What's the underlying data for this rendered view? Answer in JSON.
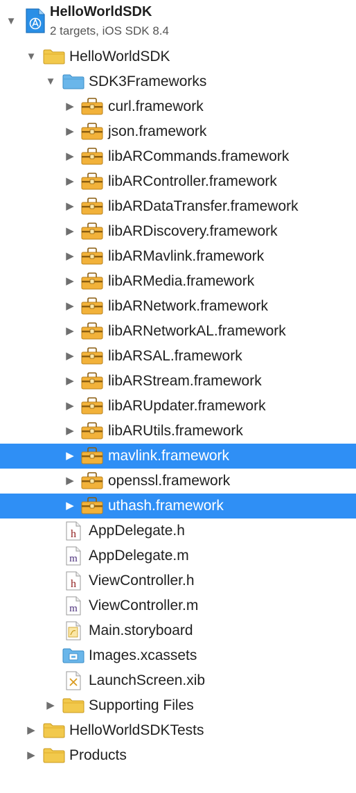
{
  "project": {
    "title": "HelloWorldSDK",
    "subtitle": "2 targets, iOS SDK 8.4",
    "icon": "xcode-project-icon"
  },
  "groups": {
    "main": "HelloWorldSDK",
    "frameworks": "SDK3Frameworks",
    "supporting": "Supporting Files",
    "tests": "HelloWorldSDKTests",
    "products": "Products"
  },
  "frameworks": [
    {
      "label": "curl.framework",
      "selected": false
    },
    {
      "label": "json.framework",
      "selected": false
    },
    {
      "label": "libARCommands.framework",
      "selected": false
    },
    {
      "label": "libARController.framework",
      "selected": false
    },
    {
      "label": "libARDataTransfer.framework",
      "selected": false
    },
    {
      "label": "libARDiscovery.framework",
      "selected": false
    },
    {
      "label": "libARMavlink.framework",
      "selected": false
    },
    {
      "label": "libARMedia.framework",
      "selected": false
    },
    {
      "label": "libARNetwork.framework",
      "selected": false
    },
    {
      "label": "libARNetworkAL.framework",
      "selected": false
    },
    {
      "label": "libARSAL.framework",
      "selected": false
    },
    {
      "label": "libARStream.framework",
      "selected": false
    },
    {
      "label": "libARUpdater.framework",
      "selected": false
    },
    {
      "label": "libARUtils.framework",
      "selected": false
    },
    {
      "label": "mavlink.framework",
      "selected": true
    },
    {
      "label": "openssl.framework",
      "selected": false
    },
    {
      "label": "uthash.framework",
      "selected": true
    }
  ],
  "files": [
    {
      "label": "AppDelegate.h",
      "type": "h",
      "icon": "header-file-icon"
    },
    {
      "label": "AppDelegate.m",
      "type": "m",
      "icon": "objc-source-file-icon"
    },
    {
      "label": "ViewController.h",
      "type": "h",
      "icon": "header-file-icon"
    },
    {
      "label": "ViewController.m",
      "type": "m",
      "icon": "objc-source-file-icon"
    },
    {
      "label": "Main.storyboard",
      "type": "storyboard",
      "icon": "storyboard-file-icon"
    },
    {
      "label": "Images.xcassets",
      "type": "xcassets",
      "icon": "asset-catalog-icon"
    },
    {
      "label": "LaunchScreen.xib",
      "type": "xib",
      "icon": "xib-file-icon"
    }
  ],
  "colors": {
    "selection": "#2f8ff5",
    "folder_yellow": "#f2c94c",
    "folder_blue": "#6ab6ea",
    "framework_orange": "#f2b23a"
  }
}
